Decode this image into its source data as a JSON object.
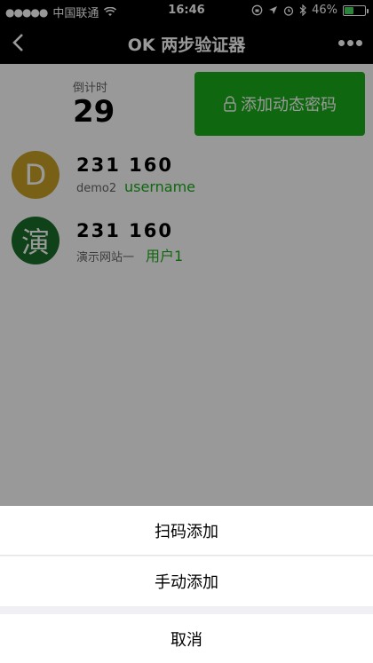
{
  "status_bar": {
    "signal": "●●●●●",
    "carrier": "中国联通",
    "time": "16:46",
    "battery": "46%",
    "battery_level": 0.46
  },
  "nav": {
    "title": "OK 两步验证器"
  },
  "countdown": {
    "label": "倒计时",
    "value": "29"
  },
  "add_button": {
    "label": "添加动态密码",
    "color": "#1aad19"
  },
  "accounts": [
    {
      "avatar": "D",
      "avatar_color": "#c9a227",
      "code": "231 160",
      "issuer": "demo2",
      "user": "username"
    },
    {
      "avatar": "演",
      "avatar_color": "#1b6e2a",
      "code": "231 160",
      "issuer": "演示网站一",
      "user": "用户1"
    }
  ],
  "action_sheet": {
    "items": [
      "扫码添加",
      "手动添加"
    ],
    "cancel": "取消"
  }
}
